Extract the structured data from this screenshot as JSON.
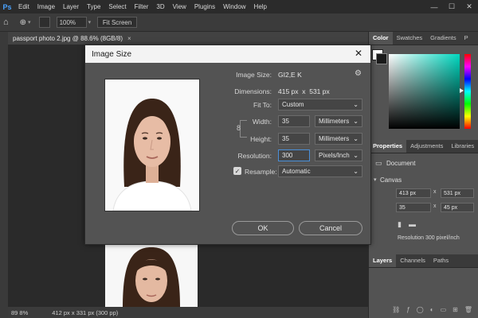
{
  "menubar": {
    "items": [
      "Edit",
      "Image",
      "Layer",
      "Type",
      "Select",
      "Filter",
      "3D",
      "View",
      "Plugins",
      "Window",
      "Help"
    ],
    "app_icon": "Ps",
    "window_controls": [
      "—",
      "☐",
      "✕"
    ]
  },
  "options_bar": {
    "zoom": "100%",
    "fit_screen_label": "Fit Screen"
  },
  "document": {
    "tab_title": "passport photo 2.jpg @ 88.6% (8GB/8)",
    "tab_close": "×"
  },
  "status_bar": {
    "zoom": "89 8%",
    "dimensions": "412 px x 331 px (300 pp)"
  },
  "right_panels": {
    "color_tabs": [
      "Color",
      "Swatches",
      "Gradients",
      "P"
    ],
    "properties_tabs": [
      "Properties",
      "Adjustments",
      "Libraries"
    ],
    "document_label": "Document",
    "canvas_label": "Canvas",
    "canvas_w": "413 px",
    "canvas_h": "531 px",
    "canvas_x": "35",
    "canvas_y": "45 px",
    "canvas_x_sep": "x",
    "resolution_text": "Resolution 300 pixel/inch",
    "layers_tabs": [
      "Layers",
      "Channels",
      "Paths"
    ]
  },
  "dialog": {
    "title": "Image Size",
    "close": "✕",
    "image_size_label": "Image Size:",
    "image_size_value": "GI2,E K",
    "dimensions_label": "Dimensions:",
    "dimensions_value": "415 px  x  531 px",
    "fit_to_label": "Fit To:",
    "fit_to_value": "Custom",
    "width_label": "Width:",
    "width_value": "35",
    "width_unit": "Millimeters",
    "height_label": "Height:",
    "height_value": "35",
    "height_unit": "Millimeters",
    "resolution_label": "Resolution:",
    "resolution_value": "300",
    "resolution_unit": "Pixels/Inch",
    "resample_label": "Resample:",
    "resample_value": "Automatic",
    "ok_label": "OK",
    "cancel_label": "Cancel"
  },
  "colors": {
    "accent": "#4aa3ff",
    "dialog_bg": "#535353",
    "canvas_bg": "#2a2a2a"
  }
}
